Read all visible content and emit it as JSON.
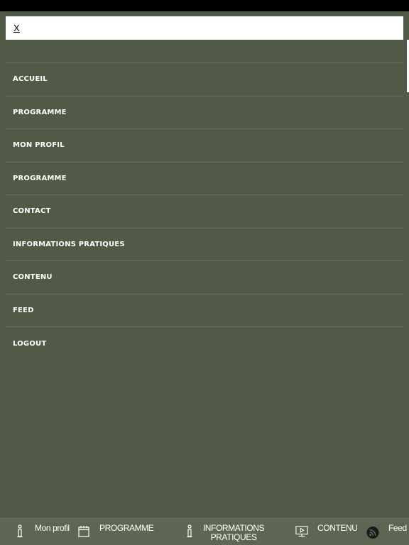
{
  "header": {
    "close_label": "X"
  },
  "menu": {
    "items": [
      {
        "label": "ACCUEIL"
      },
      {
        "label": "PROGRAMME"
      },
      {
        "label": "MON PROFIL"
      },
      {
        "label": "PROGRAMME"
      },
      {
        "label": "CONTACT"
      },
      {
        "label": "INFORMATIONS PRATIQUES"
      },
      {
        "label": "CONTENU"
      },
      {
        "label": "FEED"
      },
      {
        "label": "LOGOUT"
      }
    ]
  },
  "tab_bar": {
    "tabs": [
      {
        "label": "Mon profil",
        "icon": "info-icon"
      },
      {
        "label": "PROGRAMME",
        "icon": "calendar-icon"
      },
      {
        "label": "INFORMATIONS PRATIQUES",
        "icon": "info-icon"
      },
      {
        "label": "CONTENU",
        "icon": "video-icon"
      },
      {
        "label": "Feed",
        "icon": "rss-icon"
      }
    ]
  },
  "colors": {
    "background": "#515a47",
    "tab_bar": "#5d6553",
    "divider": "#646c5b",
    "text": "#ffffff"
  }
}
